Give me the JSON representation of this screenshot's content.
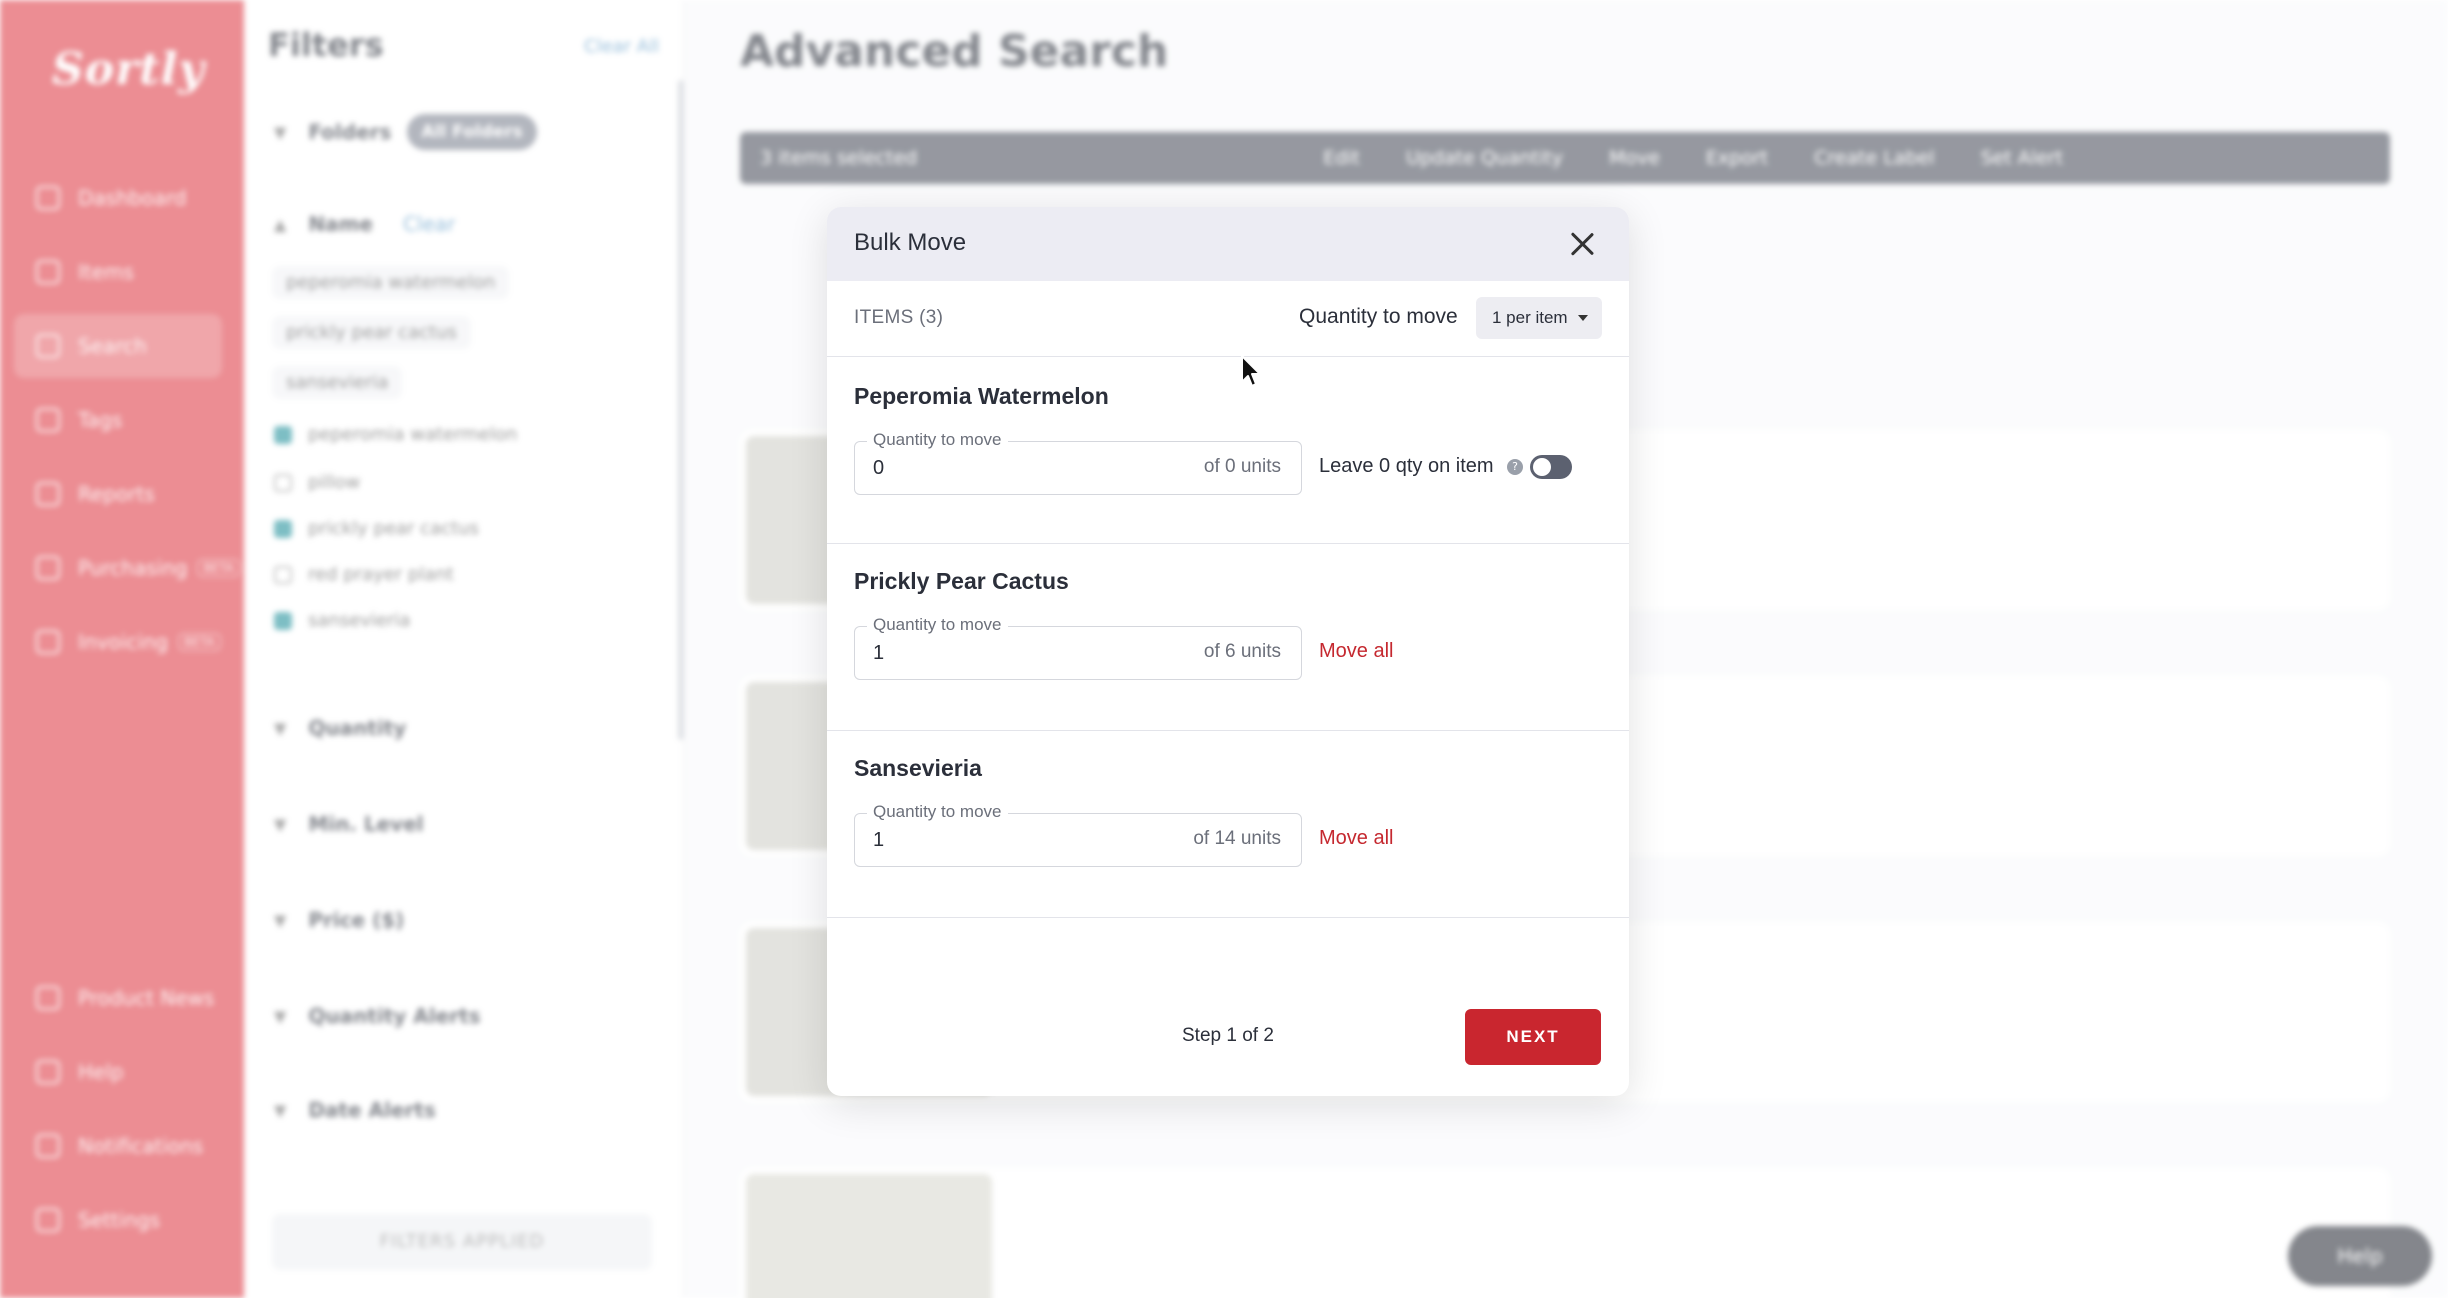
{
  "app": {
    "logo": "Sortly",
    "nav": [
      "Dashboard",
      "Items",
      "Search",
      "Tags",
      "Reports",
      "Purchasing",
      "Invoicing"
    ],
    "nav_bottom": [
      "Product News",
      "Help",
      "Notifications",
      "Settings"
    ],
    "filters_title": "Filters",
    "clear_all": "Clear All",
    "folders_label": "Folders",
    "folders_pill": "All Folders",
    "name_label": "Name",
    "name_clear": "Clear",
    "chips": [
      "peperomia watermelon",
      "prickly pear cactus",
      "sansevieria"
    ],
    "checkbox_items": [
      "peperomia watermelon",
      "pillow",
      "prickly pear cactus",
      "red prayer plant",
      "sansevieria"
    ],
    "filter_sections": [
      "Quantity",
      "Min. Level",
      "Price ($)",
      "Quantity Alerts",
      "Date Alerts"
    ],
    "filters_applied": "FILTERS APPLIED",
    "page_title": "Advanced Search",
    "toolbar": [
      "3 items selected",
      "Edit",
      "Update Quantity",
      "Move",
      "Export",
      "Create Label",
      "Set Alert"
    ],
    "help_button": "Help"
  },
  "modal": {
    "title": "Bulk Move",
    "items_count": "ITEMS (3)",
    "qty_label": "Quantity to move",
    "qty_select": "1 per item",
    "field_legend": "Quantity to move",
    "sections": [
      {
        "name": "Peperomia Watermelon",
        "value": "0",
        "of": "of 0 units",
        "leave_label": "Leave 0 qty on item"
      },
      {
        "name": "Prickly Pear Cactus",
        "value": "1",
        "of": "of 6 units",
        "action": "Move all"
      },
      {
        "name": "Sansevieria",
        "value": "1",
        "of": "of 14 units",
        "action": "Move all"
      }
    ],
    "step": "Step 1 of 2",
    "next_label": "NEXT"
  }
}
